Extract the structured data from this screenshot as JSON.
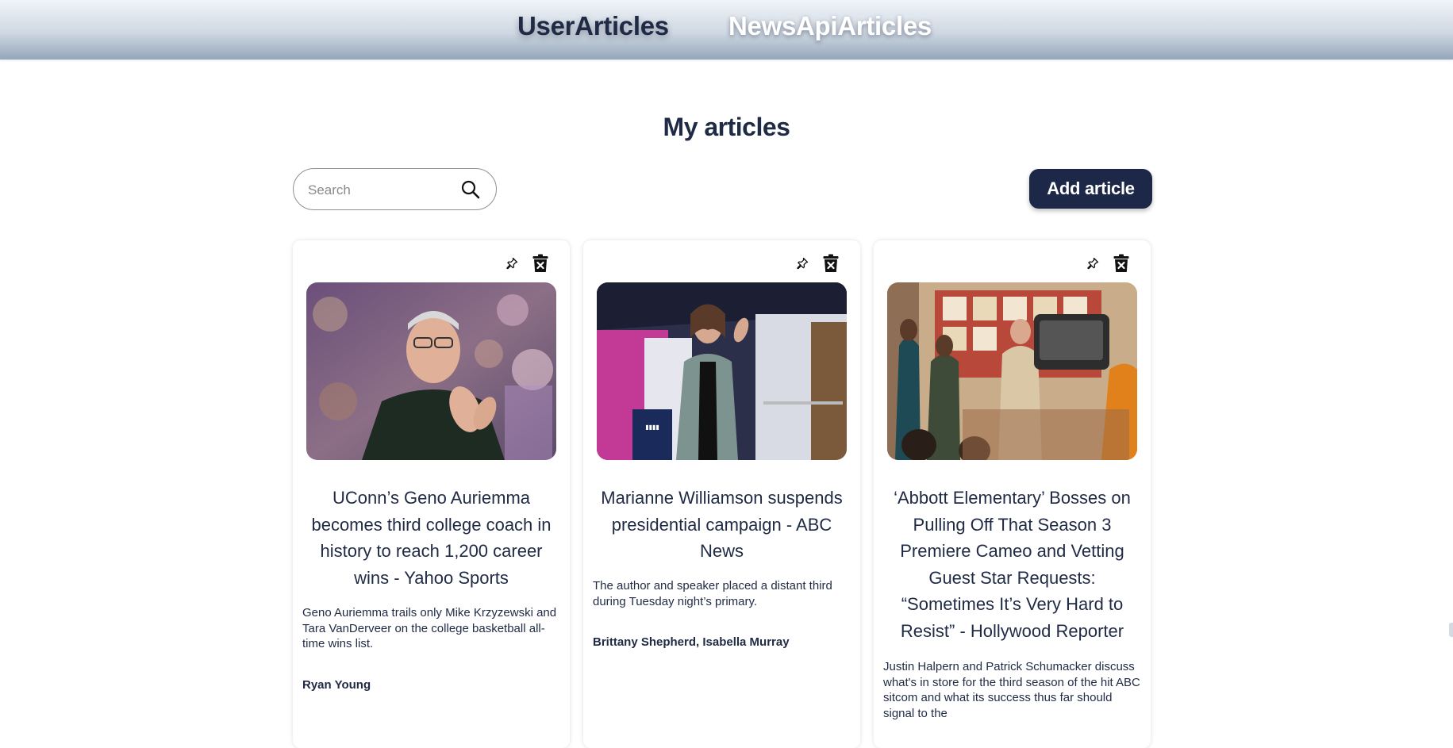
{
  "nav": {
    "user_articles": "UserArticles",
    "newsapi_articles": "NewsApiArticles"
  },
  "page": {
    "title": "My articles"
  },
  "toolbar": {
    "search_placeholder": "Search",
    "search_value": "",
    "add_label": "Add article"
  },
  "icons": {
    "search": "search-icon",
    "pin": "pin-icon",
    "delete": "trash-icon"
  },
  "colors": {
    "primary": "#1d2747",
    "text": "#1f2a44",
    "nav_gradient_top": "#f1f4f8",
    "nav_gradient_bottom": "#95a6bb"
  },
  "articles": [
    {
      "title": "UConn’s Geno Auriemma becomes third college coach in history to reach 1,200 career wins - Yahoo Sports",
      "description": "Geno Auriemma trails only Mike Krzyzewski and Tara VanDerveer on the college basketball all-time wins list.",
      "author": "Ryan Young"
    },
    {
      "title": "Marianne Williamson suspends presidential campaign - ABC News",
      "description": "The author and speaker placed a distant third during Tuesday night’s primary.",
      "author": "Brittany Shepherd, Isabella Murray"
    },
    {
      "title": "‘Abbott Elementary’ Bosses on Pulling Off That Season 3 Premiere Cameo and Vetting Guest Star Requests: “Sometimes It’s Very Hard to Resist” - Hollywood Reporter",
      "description": "Justin Halpern and Patrick Schumacker discuss what's in store for the third season of the hit ABC sitcom and what its success thus far should signal to the",
      "author": ""
    }
  ]
}
